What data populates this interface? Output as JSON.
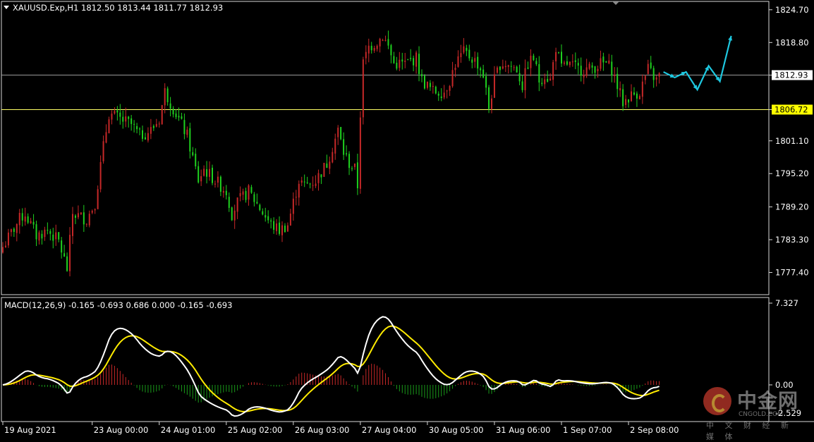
{
  "header": {
    "title": "XAUUSD.Exp,H1  1812.50 1813.44 1811.77 1812.93",
    "macd_title": "MACD(12,26,9) -0.165 -0.693 0.686 0.000 -0.165 -0.693"
  },
  "colors": {
    "background": "#000000",
    "bull": "#c62828",
    "bear": "#1fd11f",
    "hist_pos": "#c62828",
    "hist_neg": "#1a9b1a",
    "macd_line": "#ffffff",
    "signal_line": "#ffeb00",
    "level_line": "#ffff66",
    "bid_line": "#9a9a9a",
    "forecast_arrow": "#1ec8e0"
  },
  "watermark": {
    "name_cn": "中金网",
    "name_en": "CNGOLD.COM",
    "tagline": "中 文 财 经 新 媒 体"
  },
  "chart_data": [
    {
      "type": "candlestick",
      "symbol": "XAUUSD.Exp",
      "timeframe": "H1",
      "ohlc_last": {
        "open": 1812.5,
        "high": 1813.44,
        "low": 1811.77,
        "close": 1812.93
      },
      "ylim": [
        1773.4,
        1826.2
      ],
      "y_ticks": [
        "1824.70",
        "1818.80",
        "1812.93",
        "1806.72",
        "1801.10",
        "1795.20",
        "1789.20",
        "1783.30",
        "1777.40"
      ],
      "grid_tick_values": [
        1824.7,
        1818.8,
        1801.1,
        1795.2,
        1789.2,
        1783.3,
        1777.4
      ],
      "current_price": 1812.93,
      "support_level": 1806.72,
      "x_labels": [
        "19 Aug 2021",
        "23 Aug 00:00",
        "24 Aug 01:00",
        "25 Aug 02:00",
        "26 Aug 03:00",
        "27 Aug 04:00",
        "30 Aug 05:00",
        "31 Aug 06:00",
        "1 Sep 07:00",
        "2 Sep 08:00"
      ],
      "x_label_bar_index": [
        0,
        32,
        56,
        80,
        104,
        128,
        152,
        176,
        200,
        224
      ],
      "anchors": [
        [
          0,
          1782
        ],
        [
          6,
          1787
        ],
        [
          8,
          1788
        ],
        [
          12,
          1784
        ],
        [
          16,
          1785
        ],
        [
          20,
          1783
        ],
        [
          23,
          1778
        ],
        [
          25,
          1788
        ],
        [
          30,
          1787
        ],
        [
          33,
          1790
        ],
        [
          36,
          1800
        ],
        [
          38,
          1806
        ],
        [
          42,
          1805
        ],
        [
          46,
          1804
        ],
        [
          49,
          1802
        ],
        [
          53,
          1803
        ],
        [
          56,
          1805
        ],
        [
          58,
          1810
        ],
        [
          62,
          1806
        ],
        [
          66,
          1802
        ],
        [
          68,
          1798
        ],
        [
          70,
          1794
        ],
        [
          72,
          1796
        ],
        [
          76,
          1794
        ],
        [
          80,
          1792
        ],
        [
          82,
          1788
        ],
        [
          84,
          1790
        ],
        [
          88,
          1792
        ],
        [
          92,
          1789
        ],
        [
          96,
          1786
        ],
        [
          99,
          1785
        ],
        [
          102,
          1786
        ],
        [
          104,
          1790
        ],
        [
          106,
          1794
        ],
        [
          108,
          1793
        ],
        [
          112,
          1794
        ],
        [
          116,
          1797
        ],
        [
          118,
          1800
        ],
        [
          120,
          1803
        ],
        [
          122,
          1799
        ],
        [
          124,
          1797
        ],
        [
          126,
          1796
        ],
        [
          127,
          1793
        ],
        [
          128,
          1806
        ],
        [
          129,
          1815
        ],
        [
          131,
          1818
        ],
        [
          134,
          1819
        ],
        [
          136,
          1820
        ],
        [
          138,
          1818
        ],
        [
          140,
          1815
        ],
        [
          144,
          1815
        ],
        [
          148,
          1816
        ],
        [
          150,
          1812
        ],
        [
          154,
          1810
        ],
        [
          158,
          1810
        ],
        [
          160,
          1812
        ],
        [
          162,
          1815
        ],
        [
          165,
          1817
        ],
        [
          168,
          1816
        ],
        [
          170,
          1815
        ],
        [
          172,
          1813
        ],
        [
          174,
          1807
        ],
        [
          176,
          1812
        ],
        [
          178,
          1815
        ],
        [
          180,
          1815
        ],
        [
          184,
          1814
        ],
        [
          186,
          1811
        ],
        [
          188,
          1815
        ],
        [
          190,
          1816
        ],
        [
          192,
          1812
        ],
        [
          194,
          1813
        ],
        [
          196,
          1812
        ],
        [
          198,
          1818
        ],
        [
          200,
          1814
        ],
        [
          202,
          1815
        ],
        [
          206,
          1814
        ],
        [
          210,
          1814
        ],
        [
          214,
          1815
        ],
        [
          216,
          1815
        ],
        [
          218,
          1814
        ],
        [
          220,
          1811
        ],
        [
          222,
          1808
        ],
        [
          224,
          1809
        ],
        [
          228,
          1810
        ],
        [
          231,
          1814
        ],
        [
          234,
          1812
        ],
        [
          235,
          1812.9
        ]
      ],
      "forecast_path": [
        [
          1813.5,
          0
        ],
        [
          1812.5,
          1
        ],
        [
          1813.5,
          2
        ],
        [
          1810.3,
          3
        ],
        [
          1814.6,
          4
        ],
        [
          1811.8,
          5
        ],
        [
          1820.0,
          6
        ]
      ]
    },
    {
      "type": "macd",
      "params": "12,26,9",
      "values": {
        "main": -0.165,
        "signal": -0.693,
        "histogram": 0.686
      },
      "ylim": [
        -2.529,
        7.327
      ],
      "y_ticks": [
        "7.327",
        "0.00",
        "-2.529"
      ]
    }
  ]
}
